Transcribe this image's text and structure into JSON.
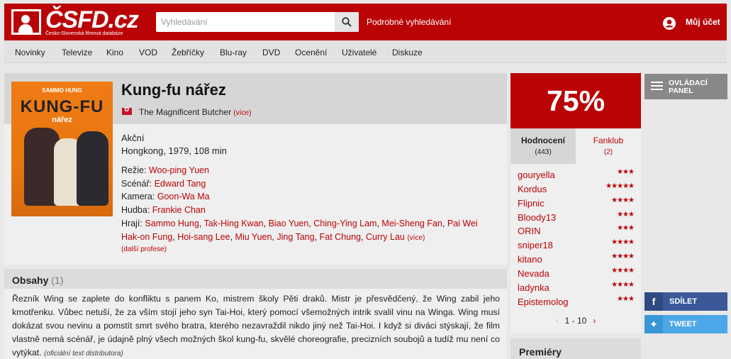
{
  "header": {
    "logo_text": "ČSFD.cz",
    "logo_sub": "Česko-Slovenská filmová databáze",
    "search_placeholder": "Vyhledávání",
    "advanced_search": "Podrobné vyhledávání",
    "account": "Můj účet"
  },
  "nav": [
    "Novinky",
    "Televize",
    "Kino",
    "VOD",
    "Žebříčky",
    "Blu-ray",
    "DVD",
    "Ocenění",
    "Uživatelé",
    "Diskuze"
  ],
  "film": {
    "poster": {
      "top_text": "SAMMO HUNG",
      "title": "KUNG-FU",
      "subtitle": "nářez"
    },
    "title": "Kung-fu nářez",
    "original_title": "The Magnificent Butcher",
    "more": "(více)",
    "genre": "Akční",
    "origin": "Hongkong, 1979, 108 min",
    "crew": {
      "director_label": "Režie:",
      "director": "Woo-ping Yuen",
      "writer_label": "Scénář:",
      "writer": "Edward Tang",
      "camera_label": "Kamera:",
      "camera": "Goon-Wa Ma",
      "music_label": "Hudba:",
      "music": "Frankie Chan",
      "cast_label": "Hrají:",
      "cast_line1": [
        "Sammo Hung",
        "Tak-Hing Kwan",
        "Biao Yuen",
        "Ching-Ying Lam",
        "Mei-Sheng Fan",
        "Pai Wei"
      ],
      "cast_line2": [
        "Hak-on Fung",
        "Hoi-sang Lee",
        "Miu Yuen",
        "Jing Tang",
        "Fat Chung",
        "Curry Lau"
      ],
      "cast_more": "(více)",
      "more_professions": "(další profese)"
    }
  },
  "plot": {
    "title": "Obsahy",
    "count": "(1)",
    "text": "Řezník Wing se zaplete do konfliktu s panem Ko, mistrem školy Pěti draků. Mistr je přesvědčený, že Wing zabil jeho kmotřenku. Vůbec netuší, že za vším stojí jeho syn Tai-Hoi, který pomocí všemožných intrik svalil vinu na Winga. Wing musí dokázat svou nevinu a pomstít smrt svého bratra, kterého nezavraždil nikdo jiný než Tai-Hoi. I když si diváci stýskají, že film vlastně nemá scénář, je údajně plný všech možných škol kung-fu, skvělé choreografie, precizních soubojů a tudíž mu není co vytýkat.",
    "source": "(oficiální text distributora)"
  },
  "rating": {
    "score": "75%",
    "tabs": [
      {
        "label": "Hodnocení",
        "count": "(443)"
      },
      {
        "label": "Fanklub",
        "count": "(2)"
      }
    ],
    "users": [
      {
        "name": "gouryella",
        "stars": 3
      },
      {
        "name": "Kordus",
        "stars": 5
      },
      {
        "name": "Flipnic",
        "stars": 4
      },
      {
        "name": "Bloody13",
        "stars": 3
      },
      {
        "name": "ORIN",
        "stars": 3
      },
      {
        "name": "sniper18",
        "stars": 4
      },
      {
        "name": "kitano",
        "stars": 4
      },
      {
        "name": "Nevada",
        "stars": 4
      },
      {
        "name": "ladynka",
        "stars": 4
      },
      {
        "name": "Epistemolog",
        "stars": 3
      }
    ],
    "pager": "1 - 10"
  },
  "premieres": "Premiéry",
  "side": {
    "control_panel": "OVLÁDACÍ PANEL",
    "share": "SDÍLET",
    "tweet": "TWEET"
  },
  "colors": {
    "brand": "#ba0305",
    "facebook": "#3b5998",
    "twitter": "#4ba7e8"
  }
}
